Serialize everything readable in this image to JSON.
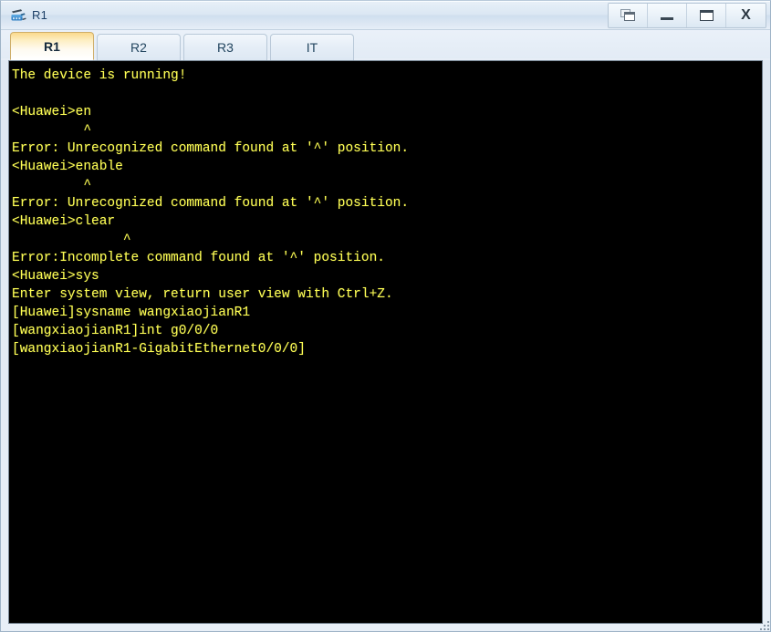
{
  "window": {
    "title": "R1",
    "icon": "router-device-icon",
    "buttons": [
      {
        "name": "restore-windows-button",
        "glyph": "restore",
        "label": ""
      },
      {
        "name": "minimize-button",
        "glyph": "minimize",
        "label": ""
      },
      {
        "name": "maximize-button",
        "glyph": "maximize",
        "label": ""
      },
      {
        "name": "close-button",
        "glyph": "close",
        "label": "X"
      }
    ]
  },
  "tabs": [
    {
      "label": "R1",
      "active": true
    },
    {
      "label": "R2",
      "active": false
    },
    {
      "label": "R3",
      "active": false
    },
    {
      "label": "IT",
      "active": false
    }
  ],
  "terminal": {
    "foreground_color": "#ffff55",
    "background_color": "#000000",
    "lines": [
      "The device is running!",
      "",
      "<Huawei>en",
      "         ^",
      "Error: Unrecognized command found at '^' position.",
      "<Huawei>enable",
      "         ^",
      "Error: Unrecognized command found at '^' position.",
      "<Huawei>clear",
      "              ^",
      "Error:Incomplete command found at '^' position.",
      "<Huawei>sys",
      "Enter system view, return user view with Ctrl+Z.",
      "[Huawei]sysname wangxiaojianR1",
      "[wangxiaojianR1]int g0/0/0",
      "[wangxiaojianR1-GigabitEthernet0/0/0]"
    ]
  }
}
